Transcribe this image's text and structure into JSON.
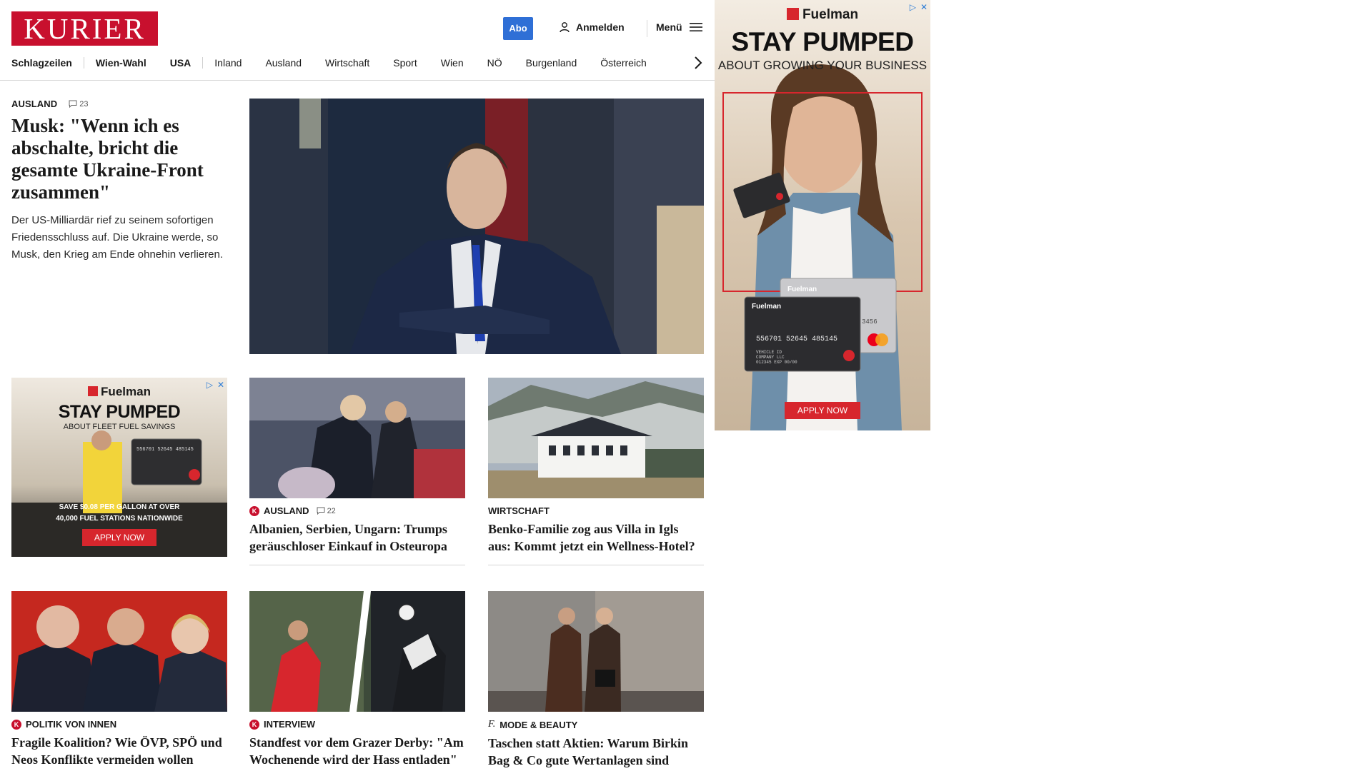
{
  "header": {
    "logo": "KURIER",
    "abo_label": "Abo",
    "login_label": "Anmelden",
    "menu_label": "Menü",
    "nav": [
      "Schlagzeilen",
      "Wien-Wahl",
      "USA",
      "Inland",
      "Ausland",
      "Wirtschaft",
      "Sport",
      "Wien",
      "NÖ",
      "Burgenland",
      "Österreich"
    ]
  },
  "lead": {
    "ressort": "AUSLAND",
    "comments": "23",
    "title": "Musk: \"Wenn ich es abschalte, bricht die gesamte Ukraine-Front zusammen\"",
    "teaser": "Der US-Milliardär rief zu seinem sofortigen Friedensschluss auf. Die Ukraine werde, so Musk, den Krieg am Ende ohnehin verlieren."
  },
  "cards": [
    {
      "ressort": "AUSLAND",
      "comments": "22",
      "badge": "K",
      "title": "Albanien, Serbien, Ungarn: Trumps geräuschloser Einkauf in Osteuropa"
    },
    {
      "ressort": "WIRTSCHAFT",
      "title": "Benko-Familie zog aus Villa in Igls aus: Kommt jetzt ein Wellness-Hotel?"
    },
    {
      "ressort": "POLITIK VON INNEN",
      "badge": "K",
      "title": "Fragile Koalition? Wie ÖVP, SPÖ und Neos Konflikte vermeiden wollen"
    },
    {
      "ressort": "INTERVIEW",
      "badge": "K",
      "title": "Standfest vor dem Grazer Derby: \"Am Wochenende wird der Hass entladen\""
    },
    {
      "ressort": "MODE & BEAUTY",
      "badge": "f.",
      "title": "Taschen statt Aktien: Warum Birkin Bag & Co gute Wertanlagen sind"
    }
  ],
  "ad_small": {
    "brand": "Fuelman",
    "headline": "STAY PUMPED",
    "subline": "ABOUT FLEET FUEL SAVINGS",
    "offer_line1": "SAVE $0.08 PER GALLON AT OVER",
    "offer_line2": "40,000 FUEL STATIONS NATIONWIDE",
    "cta": "APPLY NOW",
    "card_number": "556701 52645 485145"
  },
  "ad_side": {
    "brand": "Fuelman",
    "headline": "STAY PUMPED",
    "subline": "ABOUT GROWING YOUR BUSINESS",
    "cta": "APPLY NOW",
    "card_number": "556701 52645 485145",
    "card_digits": "3456",
    "card_line1": "VEHICLE ID",
    "card_line2": "COMPANY LLC",
    "card_line3": "012345",
    "card_exp": "EXP 00/00"
  },
  "colors": {
    "brand_red": "#c8102e",
    "abo_blue": "#2f6fd6",
    "ad_red": "#d7262d"
  }
}
